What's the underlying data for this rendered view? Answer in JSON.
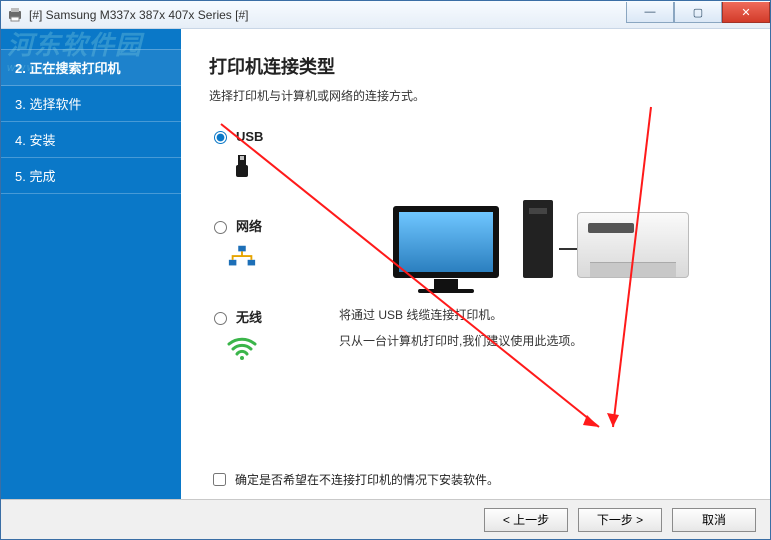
{
  "window": {
    "title": "[#] Samsung M337x 387x 407x Series [#]"
  },
  "watermark": {
    "line1": "河东软件园",
    "line2": "www.pc359.cn"
  },
  "sidebar": {
    "steps": [
      {
        "label": "2. 正在搜索打印机",
        "active": true
      },
      {
        "label": "3. 选择软件",
        "active": false
      },
      {
        "label": "4. 安装",
        "active": false
      },
      {
        "label": "5. 完成",
        "active": false
      }
    ]
  },
  "main": {
    "heading": "打印机连接类型",
    "subtitle": "选择打印机与计算机或网络的连接方式。",
    "options": {
      "usb": {
        "label": "USB",
        "selected": true
      },
      "network": {
        "label": "网络",
        "selected": false
      },
      "wireless": {
        "label": "无线",
        "selected": false
      }
    },
    "description": {
      "line1": "将通过 USB 线缆连接打印机。",
      "line2": "只从一台计算机打印时,我们建议使用此选项。"
    },
    "checkbox": {
      "label": "确定是否希望在不连接打印机的情况下安装软件。",
      "checked": false
    }
  },
  "footer": {
    "back": "< 上一步",
    "next": "下一步 >",
    "cancel": "取消"
  },
  "icons": {
    "usb": "usb-plug-icon",
    "network": "network-nodes-icon",
    "wireless": "wifi-icon"
  }
}
